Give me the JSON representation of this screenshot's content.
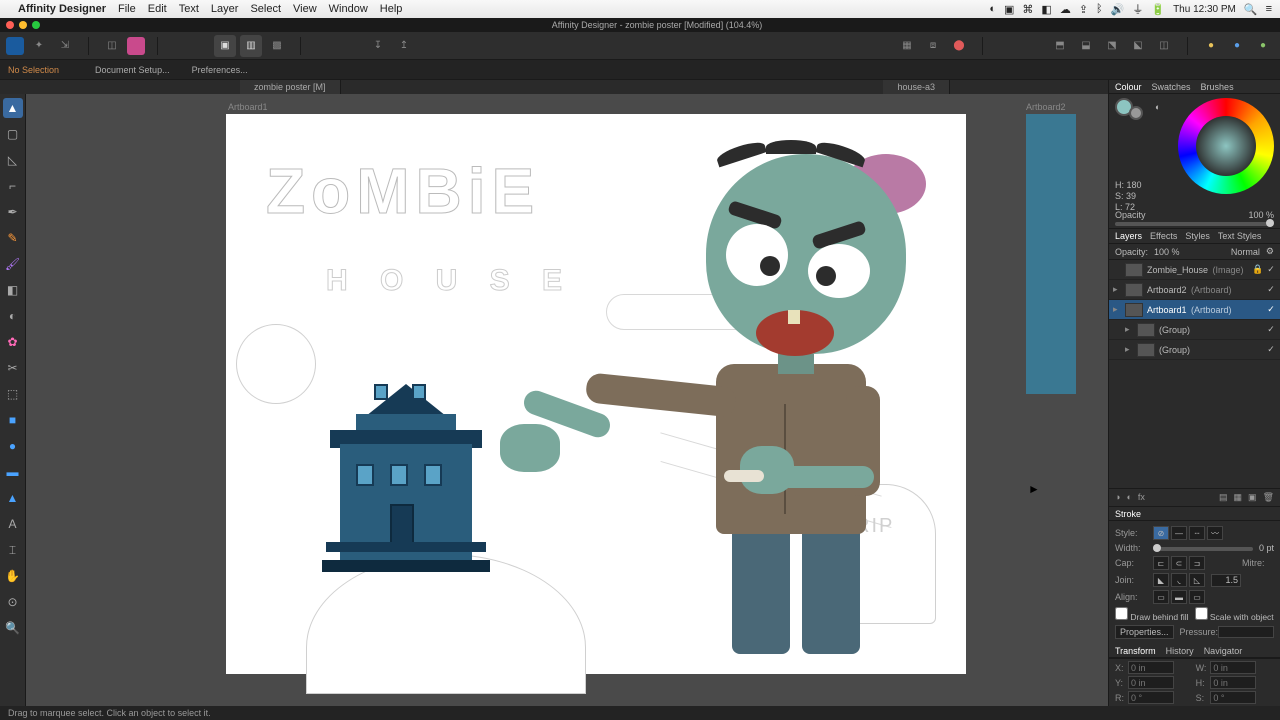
{
  "menubar": {
    "app": "Affinity Designer",
    "items": [
      "File",
      "Edit",
      "Text",
      "Layer",
      "Select",
      "View",
      "Window",
      "Help"
    ],
    "clock": "Thu 12:30 PM"
  },
  "window": {
    "title": "Affinity Designer - zombie poster [Modified] (104.4%)"
  },
  "context_bar": {
    "selection": "No Selection",
    "doc_setup": "Document Setup...",
    "prefs": "Preferences..."
  },
  "tabs": {
    "main": "zombie poster [M]",
    "secondary": "house-a3"
  },
  "artboards": {
    "a1": "Artboard1",
    "a2": "Artboard2"
  },
  "sketch": {
    "title": "ZoMBiE",
    "subtitle": "H O U S E"
  },
  "panels": {
    "colour": {
      "tabs": [
        "Colour",
        "Swatches",
        "Brushes"
      ],
      "h": "H: 180",
      "s": "S: 39",
      "l": "L: 72",
      "opacity_label": "Opacity",
      "opacity_value": "100 %"
    },
    "layers": {
      "tabs": [
        "Layers",
        "Effects",
        "Styles",
        "Text Styles"
      ],
      "opacity_label": "Opacity:",
      "opacity_value": "100 %",
      "blend": "Normal",
      "items": [
        {
          "name": "Zombie_House",
          "type": "(Image)",
          "selected": false,
          "locked": true,
          "visible": true,
          "expand": false,
          "indent": 0
        },
        {
          "name": "Artboard2",
          "type": "(Artboard)",
          "selected": false,
          "locked": false,
          "visible": true,
          "expand": true,
          "indent": 0
        },
        {
          "name": "Artboard1",
          "type": "(Artboard)",
          "selected": true,
          "locked": false,
          "visible": true,
          "expand": true,
          "indent": 0
        },
        {
          "name": "(Group)",
          "type": "",
          "selected": false,
          "locked": false,
          "visible": true,
          "expand": true,
          "indent": 1
        },
        {
          "name": "(Group)",
          "type": "",
          "selected": false,
          "locked": false,
          "visible": true,
          "expand": true,
          "indent": 1
        }
      ]
    },
    "stroke": {
      "title": "Stroke",
      "style_label": "Style:",
      "width_label": "Width:",
      "width_value": "0 pt",
      "cap_label": "Cap:",
      "join_label": "Join:",
      "align_label": "Align:",
      "mitre_label": "Mitre:",
      "mitre_value": "1.5",
      "draw_behind": "Draw behind fill",
      "scale": "Scale with object",
      "properties": "Properties...",
      "pressure": "Pressure:"
    },
    "transform": {
      "tabs": [
        "Transform",
        "History",
        "Navigator"
      ],
      "x": "X:",
      "y": "Y:",
      "w": "W:",
      "h": "H:",
      "r": "R:",
      "s": "S:",
      "xv": "0 in",
      "yv": "0 in",
      "wv": "0 in",
      "hv": "0 in",
      "rv": "0 °",
      "sv": "0 °"
    }
  },
  "status": "Drag to marquee select. Click an object to select it."
}
